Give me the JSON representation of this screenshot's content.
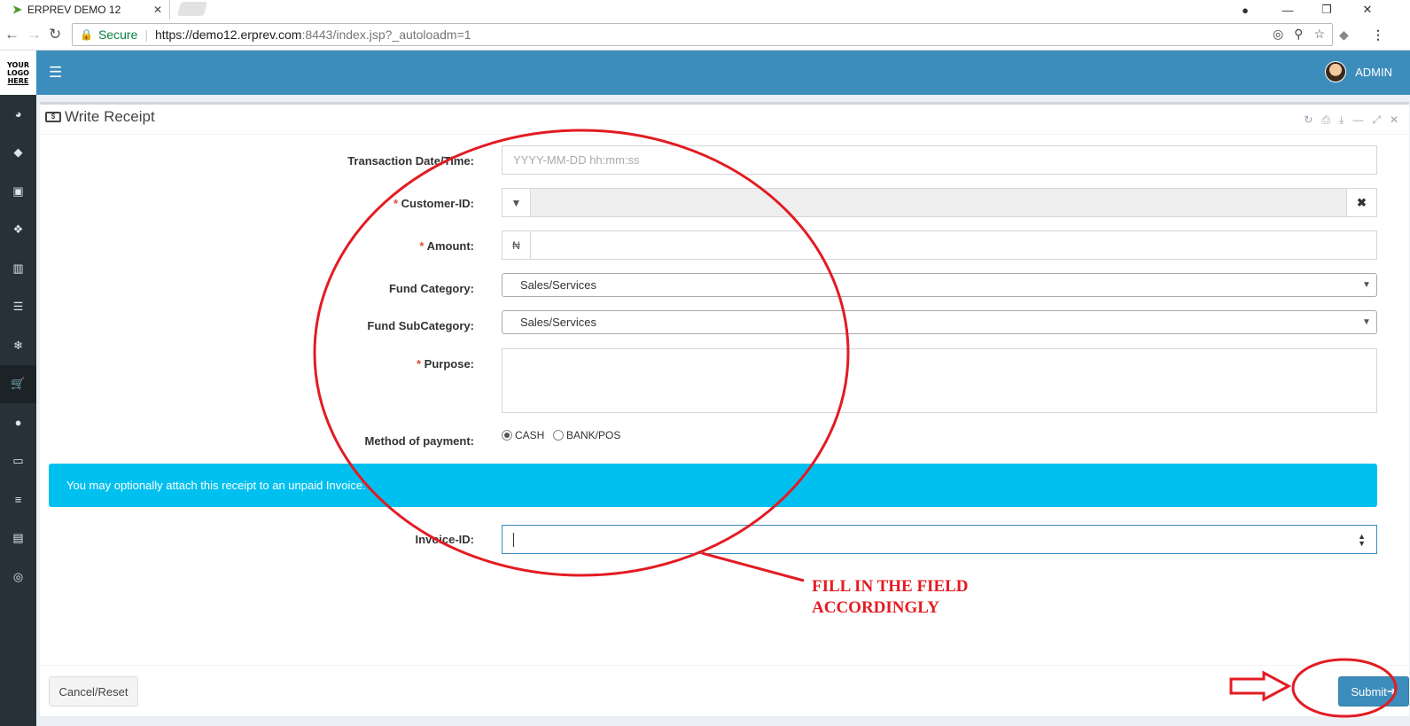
{
  "browser": {
    "tab_title": "ERPREV DEMO 12",
    "secure_label": "Secure",
    "url_main": "https://demo12.erprev.com",
    "url_rest": ":8443/index.jsp?_autoloadm=1"
  },
  "app": {
    "logo_lines": [
      "YOUR",
      "LOGO",
      "HERE"
    ],
    "user_name": "ADMIN",
    "sidebar_icons": [
      "dashboard-icon",
      "tag-icon",
      "money-icon",
      "cubes-icon",
      "building-icon",
      "database-icon",
      "snowflake-icon",
      "cart-icon",
      "circle-icon",
      "desktop-icon",
      "stack-icon",
      "book-icon",
      "support-icon"
    ],
    "active_sidebar_index": 7
  },
  "form": {
    "title": "Write Receipt",
    "transaction_label": "Transaction Date/Time:",
    "transaction_placeholder": "YYYY-MM-DD hh:mm:ss",
    "customer_label": "Customer-ID:",
    "amount_label": "Amount:",
    "amount_symbol": "₦",
    "fund_category_label": "Fund Category:",
    "fund_category_value": "Sales/Services",
    "fund_subcategory_label": "Fund SubCategory:",
    "fund_subcategory_value": "Sales/Services",
    "purpose_label": "Purpose:",
    "payment_label": "Method of payment:",
    "payment_options": [
      "CASH",
      "BANK/POS"
    ],
    "payment_selected": "CASH",
    "callout_text": "You may optionally attach this receipt to an unpaid Invoice.",
    "invoice_label": "Invoice-ID:",
    "required_mark": "*",
    "cancel_label": "Cancel/Reset",
    "submit_label": "Submit"
  },
  "annotation": {
    "text_line1": "FILL IN THE FIELD",
    "text_line2": "ACCORDINGLY",
    "color": "#e31b23"
  }
}
